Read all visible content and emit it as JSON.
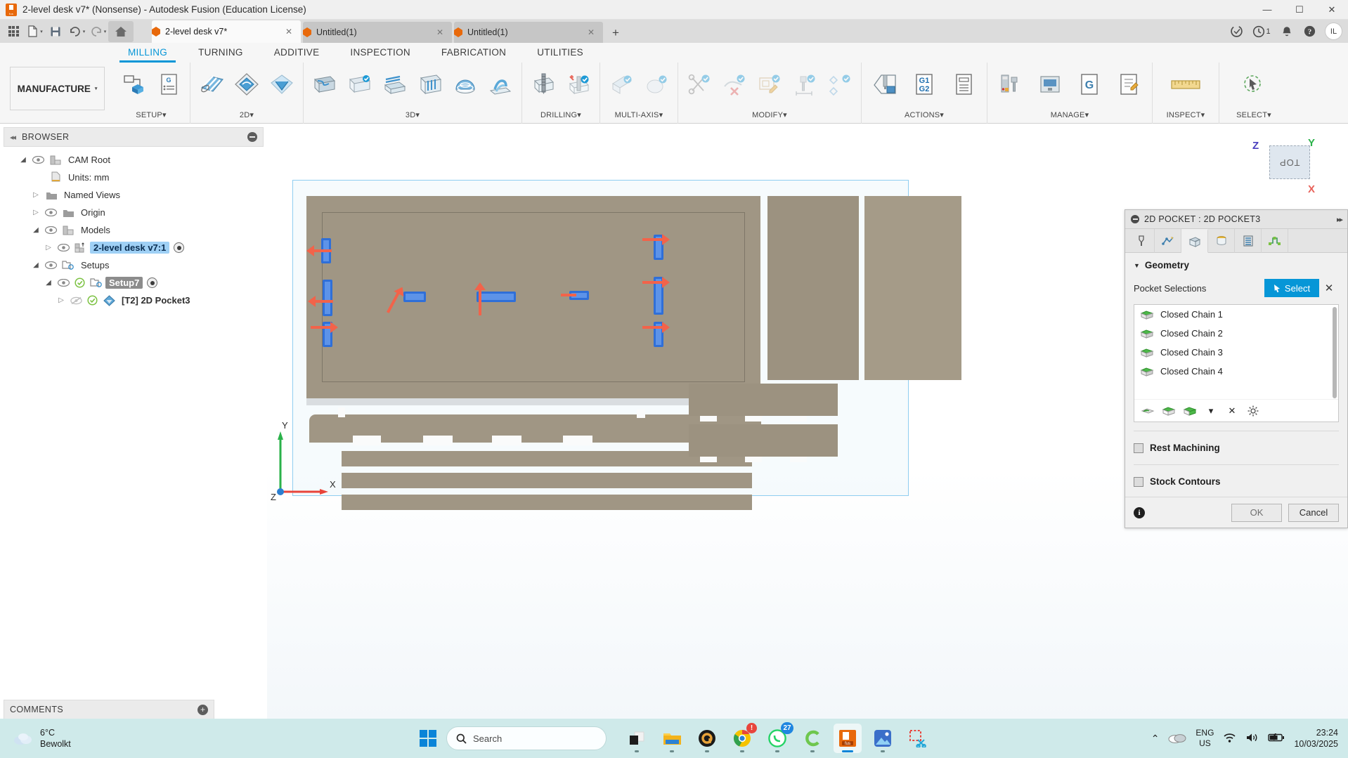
{
  "window": {
    "title": "2-level desk v7* (Nonsense) - Autodesk Fusion (Education License)",
    "logo_text": "fus",
    "minimize": "—",
    "maximize": "☐",
    "close": "✕"
  },
  "quick_access": {
    "apps_grid": "apps-grid",
    "new_label": "new-document",
    "save_label": "save",
    "undo_label": "undo",
    "redo_label": "redo",
    "home_label": "home"
  },
  "doc_tabs": [
    {
      "label": "2-level desk v7*",
      "active": true,
      "close": "✕"
    },
    {
      "label": "Untitled(1)",
      "active": false,
      "close": "✕"
    },
    {
      "label": "Untitled(1)",
      "active": false,
      "close": "✕"
    }
  ],
  "tab_add": "+",
  "account": {
    "job_status_icon": "job-status-icon",
    "recent_icon": "clock-icon",
    "recent_count": "1",
    "notifications_icon": "bell-icon",
    "help_icon": "help-icon",
    "initials": "IL"
  },
  "ribbon": {
    "workspace": "MANUFACTURE",
    "workspace_caret": "▾",
    "tabs": [
      {
        "label": "MILLING",
        "active": true
      },
      {
        "label": "TURNING",
        "active": false
      },
      {
        "label": "ADDITIVE",
        "active": false
      },
      {
        "label": "INSPECTION",
        "active": false
      },
      {
        "label": "FABRICATION",
        "active": false
      },
      {
        "label": "UTILITIES",
        "active": false
      }
    ],
    "groups": [
      {
        "label": "SETUP",
        "caret": "▾",
        "buttons": [
          {
            "name": "setup-new-setup-icon",
            "glyph": "setup"
          },
          {
            "name": "setup-ncprogram-icon",
            "glyph": "g-code"
          }
        ]
      },
      {
        "label": "2D",
        "caret": "▾",
        "buttons": [
          {
            "name": "face-icon",
            "glyph": "face"
          },
          {
            "name": "2d-adaptive-clearing-icon",
            "glyph": "adaptive"
          },
          {
            "name": "2d-pocket-icon",
            "glyph": "pocket"
          }
        ]
      },
      {
        "label": "3D",
        "caret": "▾",
        "buttons": [
          {
            "name": "3d-adaptive-clearing-icon",
            "glyph": "adaptive3d"
          },
          {
            "name": "3d-pocket-clearing-icon",
            "glyph": "pocket3d"
          },
          {
            "name": "3d-horizontal-icon",
            "glyph": "horizontal"
          },
          {
            "name": "3d-parallel-icon",
            "glyph": "parallel"
          },
          {
            "name": "3d-scallop-icon",
            "glyph": "scallop"
          },
          {
            "name": "3d-spiral-icon",
            "glyph": "spiral"
          }
        ]
      },
      {
        "label": "DRILLING",
        "caret": "▾",
        "buttons": [
          {
            "name": "drill-icon",
            "glyph": "drill"
          },
          {
            "name": "bore-icon",
            "glyph": "bore"
          }
        ]
      },
      {
        "label": "MULTI-AXIS",
        "caret": "▾",
        "buttons": [
          {
            "name": "swarf-icon",
            "glyph": "swarf"
          },
          {
            "name": "multi-axis-contour-icon",
            "glyph": "mcontour"
          }
        ]
      },
      {
        "label": "MODIFY",
        "caret": "▾",
        "buttons": [
          {
            "name": "cut-icon",
            "glyph": "scissors"
          },
          {
            "name": "delete-toolpath-icon",
            "glyph": "delete"
          },
          {
            "name": "edit-toolpath-icon",
            "glyph": "edit"
          },
          {
            "name": "tool-library-modify-icon",
            "glyph": "toollib"
          },
          {
            "name": "pattern-icon",
            "glyph": "pattern"
          }
        ]
      },
      {
        "label": "ACTIONS",
        "caret": "▾",
        "buttons": [
          {
            "name": "simulate-icon",
            "glyph": "simulate"
          },
          {
            "name": "post-process-icon",
            "glyph": "G1\nG2"
          },
          {
            "name": "setup-sheet-icon",
            "glyph": "sheet"
          }
        ]
      },
      {
        "label": "MANAGE",
        "caret": "▾",
        "buttons": [
          {
            "name": "tool-library-icon",
            "glyph": "toolcab"
          },
          {
            "name": "machine-library-icon",
            "glyph": "machine"
          },
          {
            "name": "generate-icon",
            "glyph": "generate"
          },
          {
            "name": "template-library-icon",
            "glyph": "template"
          }
        ]
      },
      {
        "label": "INSPECT",
        "caret": "▾",
        "buttons": [
          {
            "name": "measure-icon",
            "glyph": "measure"
          }
        ]
      },
      {
        "label": "SELECT",
        "caret": "▾",
        "buttons": [
          {
            "name": "select-icon",
            "glyph": "select"
          }
        ]
      }
    ]
  },
  "browser": {
    "title": "BROWSER",
    "collapse_icon": "◂◂",
    "minimize_icon": "minus-icon",
    "items": [
      {
        "label": "CAM Root",
        "indent": 0,
        "twist": "open",
        "eye": true,
        "icon": "cam-root-icon",
        "style": "plain"
      },
      {
        "label": "Units: mm",
        "indent": 1,
        "twist": "none",
        "eye": false,
        "icon": "units-icon",
        "style": "plain"
      },
      {
        "label": "Named Views",
        "indent": 1,
        "twist": "closed",
        "eye": false,
        "icon": "folder-icon",
        "style": "plain"
      },
      {
        "label": "Origin",
        "indent": 1,
        "twist": "closed",
        "eye": true,
        "icon": "folder-icon",
        "style": "plain"
      },
      {
        "label": "Models",
        "indent": 1,
        "twist": "open",
        "eye": true,
        "icon": "models-icon",
        "style": "plain"
      },
      {
        "label": "2-level desk v7:1",
        "indent": 2,
        "twist": "closed",
        "eye": true,
        "icon": "component-icon",
        "style": "sel-blue",
        "radio": true
      },
      {
        "label": "Setups",
        "indent": 1,
        "twist": "open",
        "eye": true,
        "icon": "setup-icon",
        "style": "plain"
      },
      {
        "label": "Setup7",
        "indent": 2,
        "twist": "open",
        "eye": true,
        "icon": "setup-icon",
        "style": "sel-gray",
        "check": true,
        "radio": true
      },
      {
        "label": "[T2] 2D Pocket3",
        "indent": 3,
        "twist": "closed",
        "eye": "off",
        "icon": "pocket-op-icon",
        "style": "bold",
        "check": true
      }
    ]
  },
  "comments": {
    "title": "COMMENTS",
    "add_icon": "+"
  },
  "viewcube": {
    "face": "TOP",
    "axis_z": "Z",
    "axis_y": "Y",
    "axis_x": "X"
  },
  "viewport": {
    "axis_x_label": "X",
    "axis_y_label": "Y",
    "axis_z_label": "Z"
  },
  "nav_toolbar": [
    {
      "name": "orbit-icon",
      "caret": true
    },
    {
      "name": "look-at-icon",
      "caret": false
    },
    {
      "name": "pan-icon",
      "caret": false
    },
    {
      "name": "zoom-icon",
      "caret": false
    },
    {
      "name": "zoom-window-icon",
      "caret": true
    },
    {
      "name": "display-settings-icon",
      "caret": true
    },
    {
      "name": "grid-snaps-icon",
      "caret": true
    },
    {
      "name": "viewports-icon",
      "caret": true
    },
    {
      "name": "section-analysis-icon",
      "caret": true
    },
    {
      "name": "refresh-icon",
      "caret": true
    },
    {
      "name": "visual-style-icon",
      "caret": true
    },
    {
      "name": "machine-display-icon",
      "caret": true
    },
    {
      "name": "tool-display-icon",
      "caret": true
    },
    {
      "name": "toolpath-display-icon",
      "caret": true
    }
  ],
  "dialog": {
    "title": "2D POCKET : 2D POCKET3",
    "collapse_icon": "minus-icon",
    "expand_icon": "▸▸",
    "tabs": [
      {
        "name": "tool-tab",
        "active": false
      },
      {
        "name": "passes-tab",
        "active": false
      },
      {
        "name": "geometry-tab",
        "active": true
      },
      {
        "name": "heights-tab",
        "active": false
      },
      {
        "name": "passes2-tab",
        "active": false
      },
      {
        "name": "linking-tab",
        "active": false
      }
    ],
    "section": {
      "title": "Geometry",
      "triangle": "▼"
    },
    "pocket_selections_label": "Pocket Selections",
    "select_button": "Select",
    "clear_icon": "✕",
    "selections": [
      "Closed Chain 1",
      "Closed Chain 2",
      "Closed Chain 3",
      "Closed Chain 4"
    ],
    "list_toolbar": [
      {
        "name": "select-faces-icon"
      },
      {
        "name": "select-chains-icon"
      },
      {
        "name": "select-silhouette-icon"
      },
      {
        "name": "dropdown-caret-icon",
        "glyph": "▾"
      },
      {
        "name": "remove-selection-icon",
        "glyph": "✕"
      },
      {
        "name": "selection-settings-icon"
      }
    ],
    "rest_machining": {
      "label": "Rest Machining",
      "checked": false
    },
    "stock_contours": {
      "label": "Stock Contours",
      "checked": false
    },
    "info_icon": "i",
    "ok_button": "OK",
    "cancel_button": "Cancel"
  },
  "taskbar": {
    "weather": {
      "temp": "6°C",
      "condition": "Bewolkt",
      "icon": "cloud-icon"
    },
    "start": "windows-start-icon",
    "search": {
      "placeholder": "Search",
      "icon": "search-icon"
    },
    "apps": [
      {
        "name": "taskview-icon",
        "active": false,
        "badge": ""
      },
      {
        "name": "file-explorer-icon",
        "active": false,
        "badge": ""
      },
      {
        "name": "adobe-icon",
        "active": false,
        "badge": ""
      },
      {
        "name": "chrome-icon",
        "active": false,
        "badge": "!"
      },
      {
        "name": "whatsapp-icon",
        "active": false,
        "badge": "27"
      },
      {
        "name": "c-app-icon",
        "active": false,
        "badge": ""
      },
      {
        "name": "fusion-icon",
        "active": true,
        "badge": ""
      },
      {
        "name": "photos-icon",
        "active": false,
        "badge": ""
      },
      {
        "name": "snipping-tool-icon",
        "active": false,
        "badge": ""
      }
    ],
    "tray": {
      "chevron": "⌃",
      "cloud_icon": "onedrive-icon",
      "lang_top": "ENG",
      "lang_bottom": "US",
      "wifi_icon": "wifi-icon",
      "volume_icon": "volume-icon",
      "battery_icon": "battery-charging-icon",
      "time": "23:24",
      "date": "10/03/2025"
    }
  }
}
